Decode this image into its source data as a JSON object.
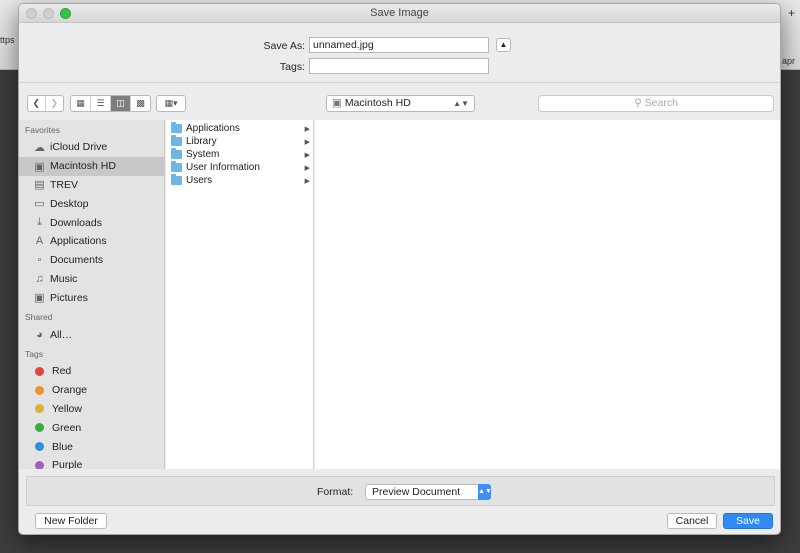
{
  "background": {
    "fragments": [
      "ttps",
      "apr",
      "+"
    ]
  },
  "dialog": {
    "title": "Save Image",
    "save_as_label": "Save As:",
    "save_as_value": "unnamed.jpg",
    "tags_label": "Tags:",
    "tags_value": "",
    "location": "Macintosh HD",
    "search_placeholder": "Search"
  },
  "sidebar": {
    "favorites_header": "Favorites",
    "favorites": [
      {
        "label": "iCloud Drive",
        "icon": "cloud-icon"
      },
      {
        "label": "Macintosh HD",
        "icon": "hard-drive-icon",
        "selected": true
      },
      {
        "label": "TREV",
        "icon": "folder-icon"
      },
      {
        "label": "Desktop",
        "icon": "desktop-icon"
      },
      {
        "label": "Downloads",
        "icon": "downloads-icon"
      },
      {
        "label": "Applications",
        "icon": "applications-icon"
      },
      {
        "label": "Documents",
        "icon": "documents-icon"
      },
      {
        "label": "Music",
        "icon": "music-icon"
      },
      {
        "label": "Pictures",
        "icon": "camera-icon"
      }
    ],
    "shared_header": "Shared",
    "shared": [
      {
        "label": "All…",
        "icon": "network-icon"
      }
    ],
    "tags_header": "Tags",
    "tags": [
      {
        "label": "Red",
        "color": "#e0443e"
      },
      {
        "label": "Orange",
        "color": "#f0912e"
      },
      {
        "label": "Yellow",
        "color": "#d9b430"
      },
      {
        "label": "Green",
        "color": "#3aac3c"
      },
      {
        "label": "Blue",
        "color": "#2d8fe0"
      },
      {
        "label": "Purple",
        "color": "#a55ec6"
      }
    ]
  },
  "browser": {
    "column1": [
      {
        "label": "Applications"
      },
      {
        "label": "Library"
      },
      {
        "label": "System"
      },
      {
        "label": "User Information"
      },
      {
        "label": "Users"
      }
    ]
  },
  "footer": {
    "format_label": "Format:",
    "format_value": "Preview Document",
    "new_folder_label": "New Folder",
    "cancel_label": "Cancel",
    "save_label": "Save"
  }
}
